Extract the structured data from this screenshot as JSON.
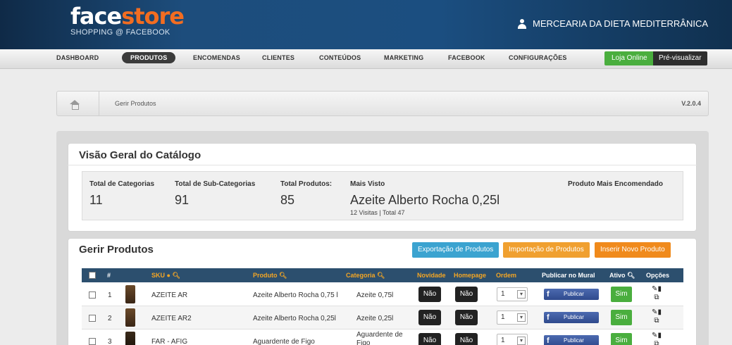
{
  "header": {
    "logo_face": "face",
    "logo_store": "store",
    "logo_sub": "SHOPPING @ FACEBOOK",
    "store_name": "MERCEARIA DA DIETA MEDITERRÂNICA"
  },
  "nav": {
    "items": [
      "DASHBOARD",
      "PRODUTOS",
      "ENCOMENDAS",
      "CLIENTES",
      "CONTEÚDOS",
      "MARKETING",
      "FACEBOOK",
      "CONFIGURAÇÕES"
    ],
    "active": "PRODUTOS",
    "loja_online": "Loja Online",
    "pre_visualizar": "Pré-visualizar"
  },
  "breadcrumb": {
    "label": "Gerir Produtos",
    "version": "V.2.0.4"
  },
  "overview": {
    "title": "Visão Geral do Catálogo",
    "total_categorias_label": "Total de Categorias",
    "total_categorias": "11",
    "total_subcategorias_label": "Total de Sub-Categorias",
    "total_subcategorias": "91",
    "total_produtos_label": "Total Produtos:",
    "total_produtos": "85",
    "mais_visto_label": "Mais Visto",
    "mais_visto": "Azeite Alberto Rocha 0,25l",
    "mais_visto_sub": "12 Visitas | Total 47",
    "mais_encomendado_label": "Produto Mais Encomendado"
  },
  "manage": {
    "title": "Gerir Produtos",
    "btn_export": "Exportação de Produtos",
    "btn_import": "Importação de Produtos",
    "btn_insert": "Inserir Novo Produto",
    "columns": {
      "num": "#",
      "sku": "SKU",
      "produto": "Produto",
      "categoria": "Categoria",
      "novidade": "Novidade",
      "homepage": "Homepage",
      "ordem": "Ordem",
      "publicar": "Publicar no Mural",
      "ativo": "Ativo",
      "opcoes": "Opções"
    },
    "rows": [
      {
        "num": "1",
        "sku": "AZEITE AR",
        "produto": "Azeite Alberto Rocha 0,75 l",
        "categoria": "Azeite 0,75l",
        "novidade": "Não",
        "homepage": "Não",
        "ordem": "1",
        "publicar": "Publicar",
        "ativo": "Sim"
      },
      {
        "num": "2",
        "sku": "AZEITE AR2",
        "produto": "Azeite Alberto Rocha 0,25l",
        "categoria": "Azeite 0,25l",
        "novidade": "Não",
        "homepage": "Não",
        "ordem": "1",
        "publicar": "Publicar",
        "ativo": "Sim"
      },
      {
        "num": "3",
        "sku": "FAR - AFIG",
        "produto": "Aguardente de Figo",
        "categoria": "Aguardente de Figo",
        "novidade": "Não",
        "homepage": "Não",
        "ordem": "1",
        "publicar": "Publicar",
        "ativo": "Sim"
      }
    ]
  },
  "colors": {
    "header_bg": "#1b4e80",
    "accent_orange": "#f26d21",
    "green": "#4aae3e",
    "blue_btn": "#3ba3d0",
    "table_head": "#2c4f6e"
  }
}
